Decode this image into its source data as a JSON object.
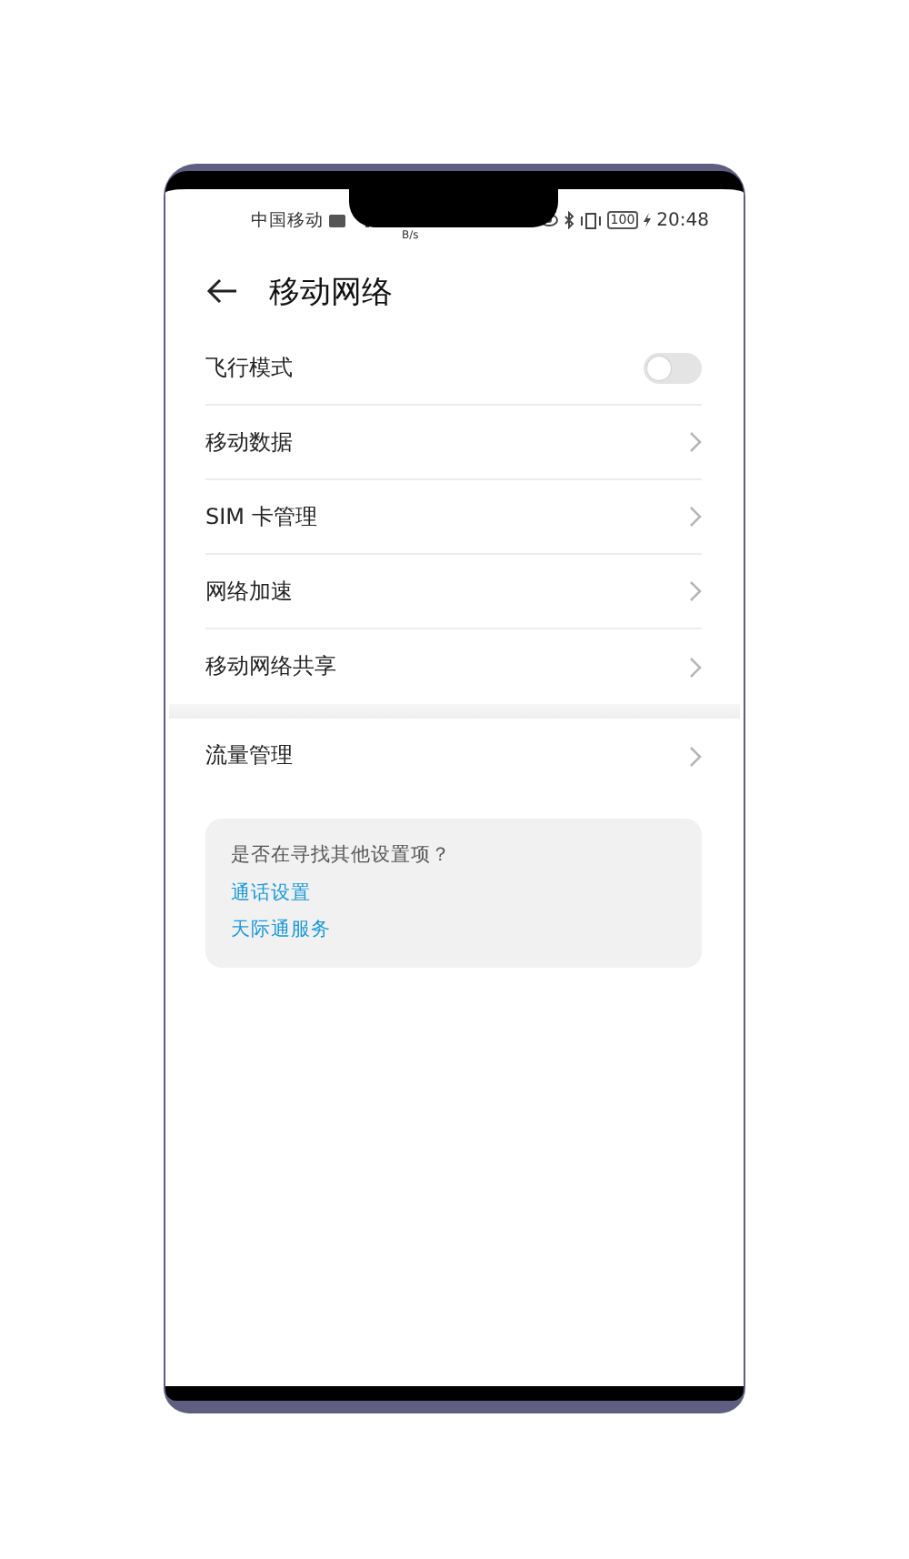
{
  "status_bar": {
    "carrier": "中国移动",
    "speed_unit": "B/s",
    "battery": "100",
    "time": "20:48"
  },
  "header": {
    "title": "移动网络"
  },
  "settings": [
    {
      "label": "飞行模式",
      "kind": "toggle",
      "on": false
    },
    {
      "label": "移动数据",
      "kind": "link"
    },
    {
      "label": "SIM 卡管理",
      "kind": "link"
    },
    {
      "label": "网络加速",
      "kind": "link"
    },
    {
      "label": "移动网络共享",
      "kind": "link"
    }
  ],
  "secondary": [
    {
      "label": "流量管理",
      "kind": "link"
    }
  ],
  "suggestions": {
    "prompt": "是否在寻找其他设置项？",
    "links": [
      "通话设置",
      "天际通服务"
    ]
  }
}
